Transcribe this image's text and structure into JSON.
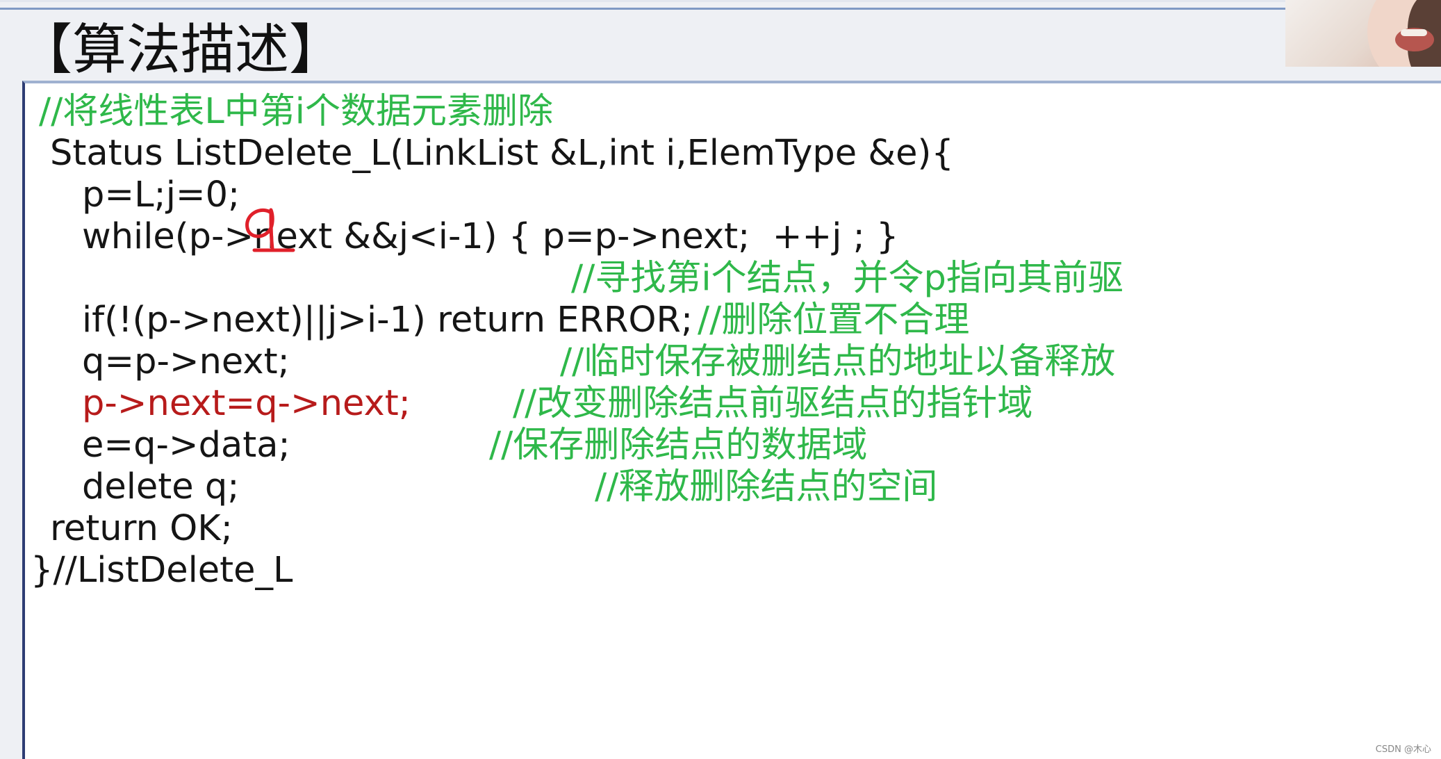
{
  "section_title": "【算法描述】",
  "code": {
    "comment_header": "//将线性表L中第i个数据元素删除",
    "signature": "Status ListDelete_L(LinkList &L,int i,ElemType &e){",
    "init": "p=L;j=0;",
    "while_line": "while(p->next &&j<i-1) { p=p->next;  ++j ; }",
    "comment_find": "//寻找第i个结点，并令p指向其前驱",
    "if_line": "if(!(p->next)||j>i-1) return ERROR;",
    "comment_if": "//删除位置不合理",
    "q_assign": "q=p->next;",
    "comment_q": "//临时保存被删结点的地址以备释放",
    "link_change": "p->next=q->next;",
    "comment_link": "//改变删除结点前驱结点的指针域",
    "e_assign": "e=q->data;",
    "comment_e": "//保存删除结点的数据域",
    "delete_line": "delete q;",
    "comment_delete": "//释放删除结点的空间",
    "return_line": "return OK;",
    "closing": "}//ListDelete_L"
  },
  "annotation": {
    "handwritten_text": "q",
    "color": "#e0202a"
  },
  "watermark": "CSDN @木心",
  "colors": {
    "comment": "#2fb84a",
    "highlight_line": "#b71b1b",
    "code_text": "#151515",
    "title_rule": "#7f99c4",
    "frame_border": "#2e3d74"
  }
}
